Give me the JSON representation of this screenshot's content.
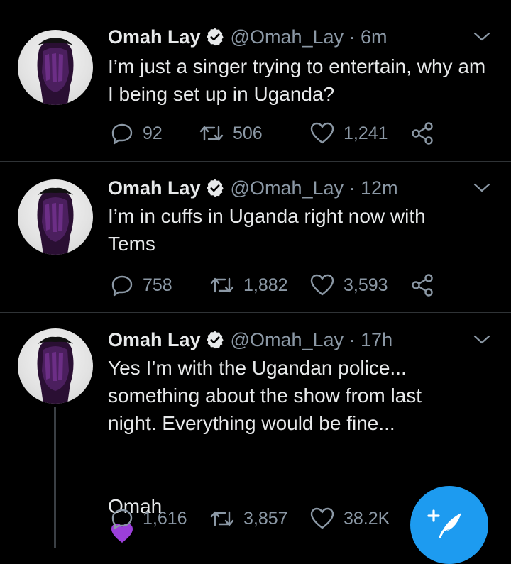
{
  "tweets": [
    {
      "author": "Omah Lay",
      "handle": "@Omah_Lay",
      "time": "6m",
      "text": "I’m just a singer trying to entertain, why am I being set up in Uganda?",
      "replies": "92",
      "retweets": "506",
      "likes": "1,241"
    },
    {
      "author": "Omah Lay",
      "handle": "@Omah_Lay",
      "time": "12m",
      "text": "I’m in cuffs in Uganda right now with Tems",
      "replies": "758",
      "retweets": "1,882",
      "likes": "3,593"
    },
    {
      "author": "Omah Lay",
      "handle": "@Omah_Lay",
      "time": "17h",
      "text": "Yes I’m with the Ugandan police... something about the show from last night. Everything would be fine...",
      "signoff": "Omah",
      "replies": "1,616",
      "retweets": "3,857",
      "likes": "38.2K"
    }
  ],
  "icons": {
    "verified": "verified-badge-icon",
    "reply": "reply-icon",
    "retweet": "retweet-icon",
    "like": "like-icon",
    "share": "share-icon",
    "more": "chevron-down-icon",
    "compose": "compose-tweet-icon",
    "emoji": "purple-heart-emoji"
  },
  "colors": {
    "background": "#000000",
    "text": "#e7e9ea",
    "secondary": "#8b98a5",
    "accent": "#1d9bf0",
    "divider": "#2f3336",
    "emoji_heart": "#9b3fd9"
  }
}
